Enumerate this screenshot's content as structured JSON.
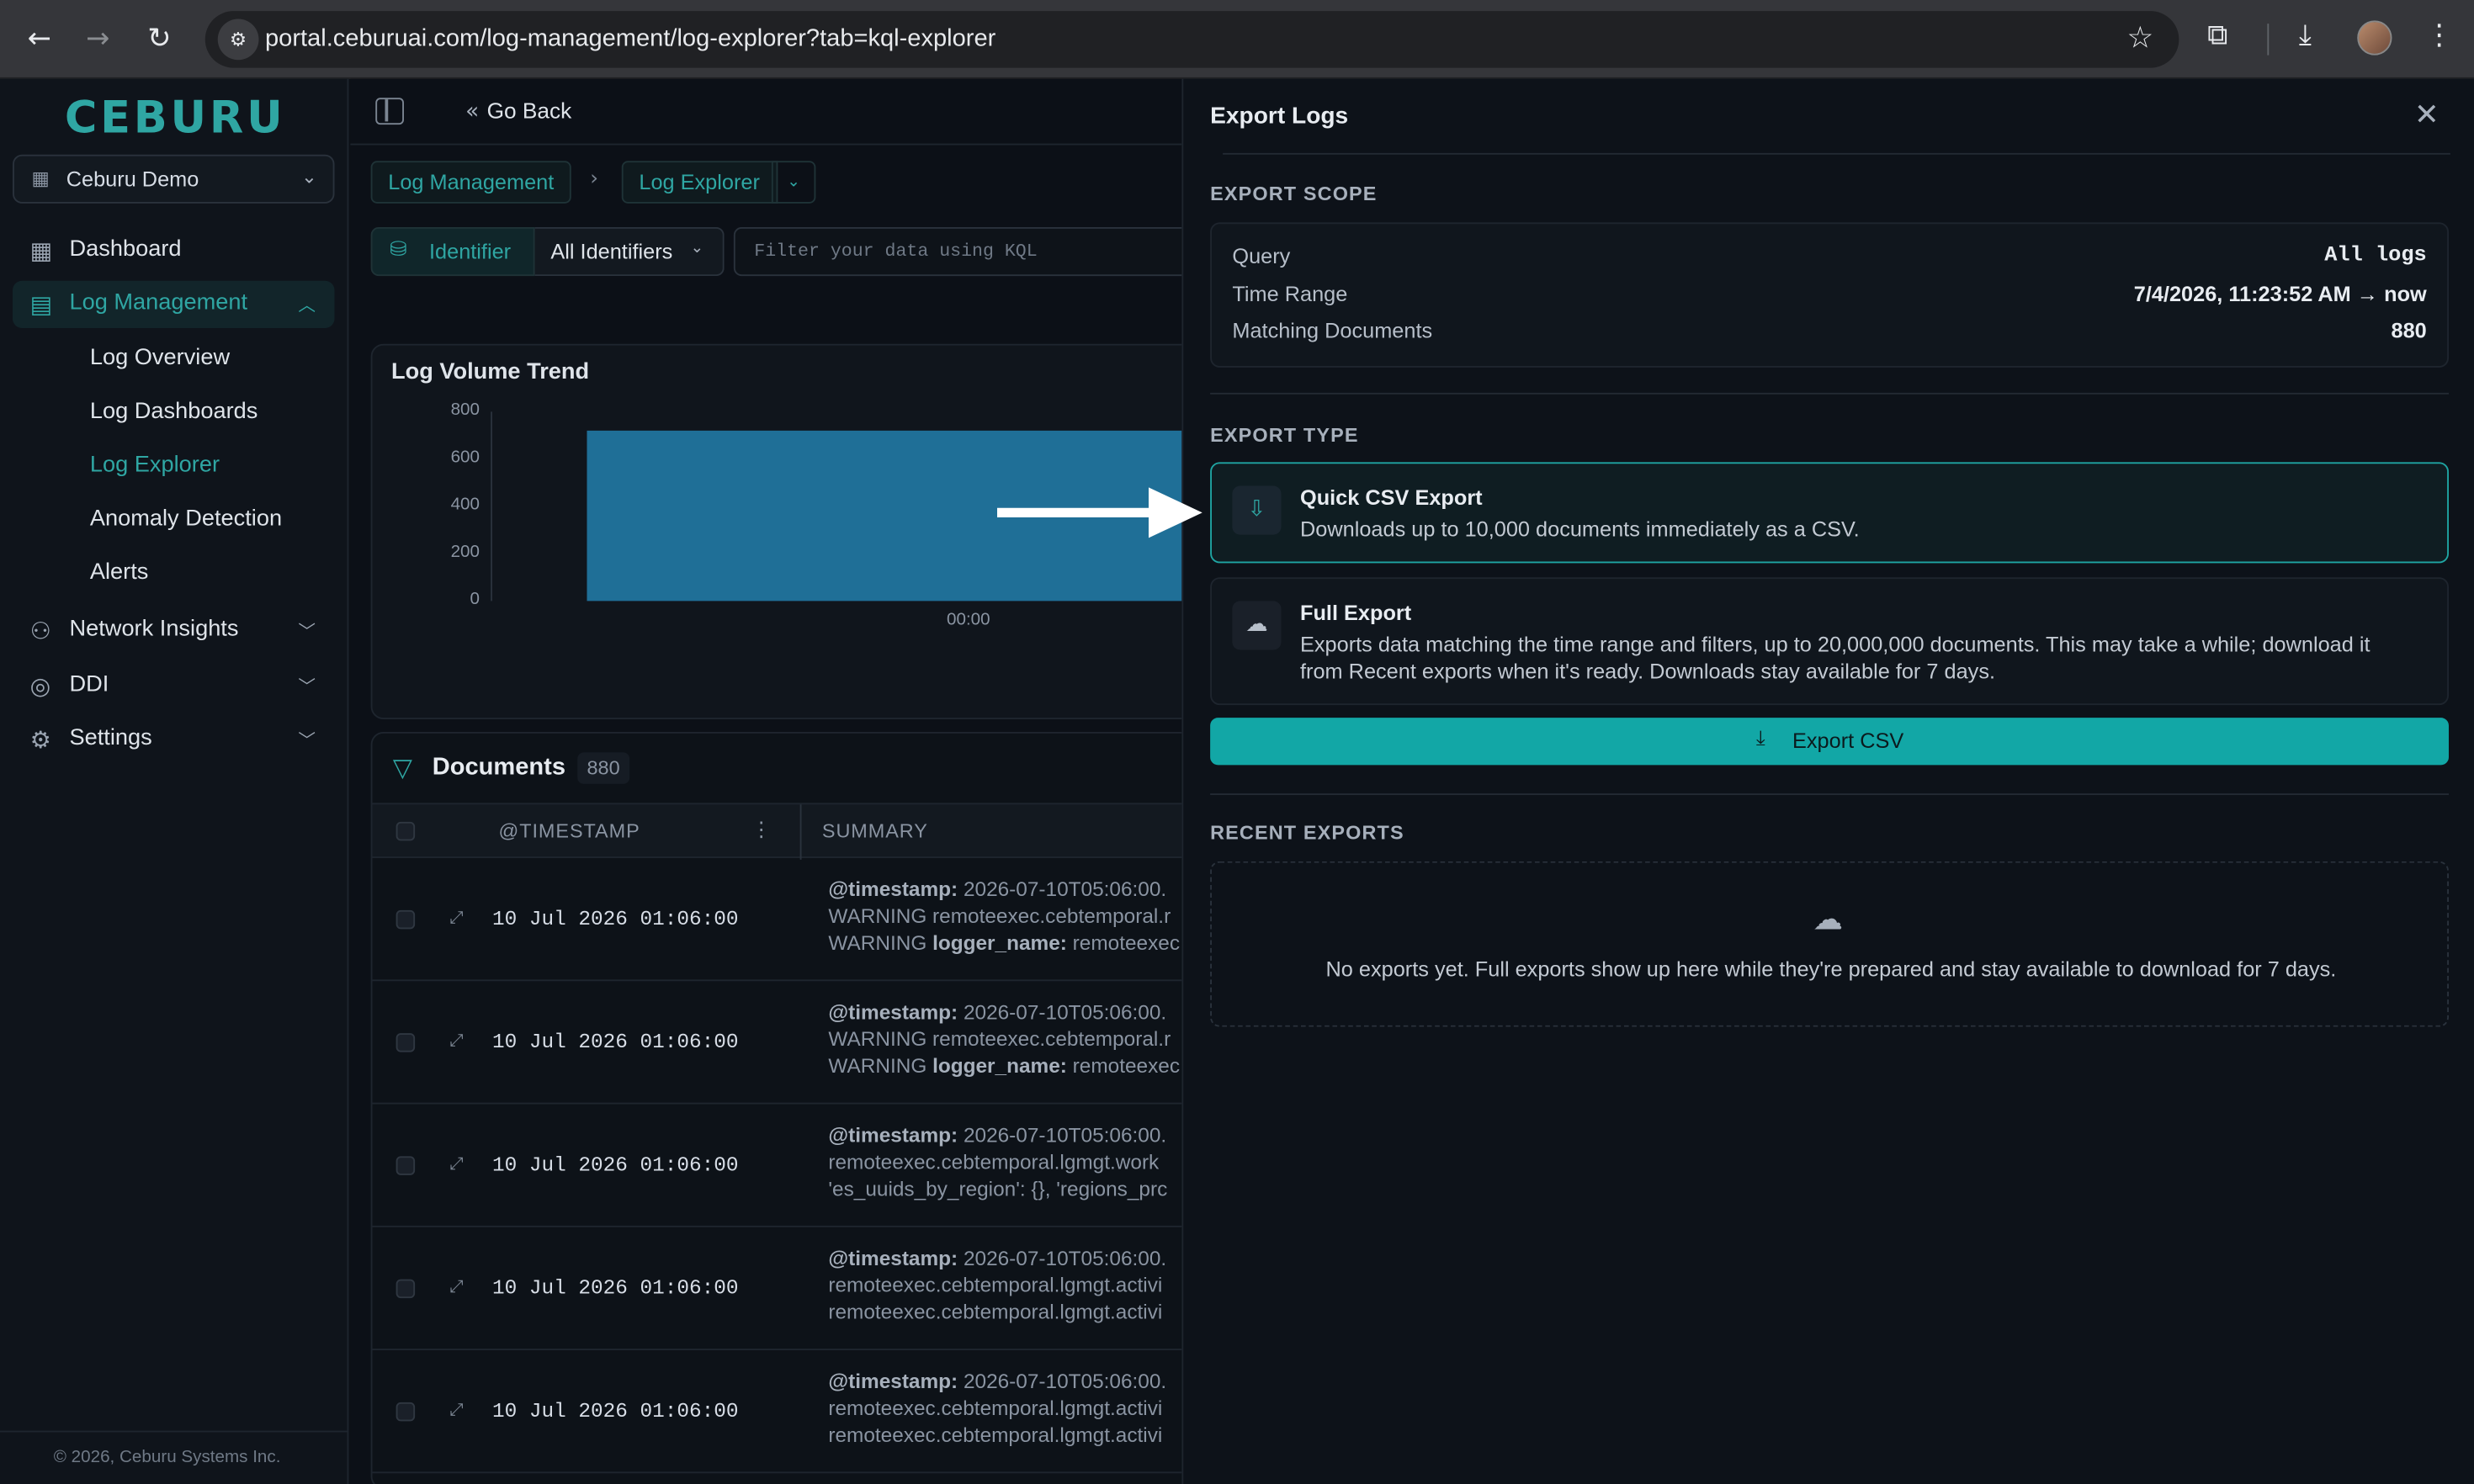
{
  "browser": {
    "url": "portal.ceburuai.com/log-management/log-explorer?tab=kql-explorer",
    "icons": [
      "back-icon",
      "forward-icon",
      "reload-icon",
      "site-info-icon",
      "bookmark-star-icon",
      "extensions-icon",
      "download-icon",
      "profile-avatar",
      "menu-icon"
    ]
  },
  "sidebar": {
    "logo": "CEBURU",
    "org": "Ceburu Demo",
    "items": [
      {
        "label": "Dashboard",
        "icon": "grid-icon"
      },
      {
        "label": "Log Management",
        "icon": "document-icon",
        "active": true
      },
      {
        "label": "Network Insights",
        "icon": "network-icon"
      },
      {
        "label": "DDI",
        "icon": "globe-icon"
      },
      {
        "label": "Settings",
        "icon": "gear-icon"
      }
    ],
    "sub_items": [
      "Log Overview",
      "Log Dashboards",
      "Log Explorer",
      "Anomaly Detection",
      "Alerts"
    ],
    "footer": "© 2026, Ceburu Systems Inc."
  },
  "main": {
    "go_back": "Go Back",
    "breadcrumb": [
      "Log Management",
      "Log Explorer"
    ],
    "identifier_label": "Identifier",
    "identifier_value": "All Identifiers",
    "kql_placeholder": "Filter your data using KQL",
    "chart_title": "Log Volume Trend",
    "documents_title": "Documents",
    "documents_count": "880",
    "columns": [
      "@TIMESTAMP",
      "SUMMARY"
    ],
    "rows": [
      {
        "ts": "10 Jul 2026 01:06:00",
        "l1k": "@timestamp:",
        "l1v": " 2026-07-10T05:06:00.",
        "l2": "WARNING remoteexec.cebtemporal.r",
        "l3k": "WARNING logger_name:",
        "l3v": " remoteexec"
      },
      {
        "ts": "10 Jul 2026 01:06:00",
        "l1k": "@timestamp:",
        "l1v": " 2026-07-10T05:06:00.",
        "l2": "WARNING remoteexec.cebtemporal.r",
        "l3k": "WARNING logger_name:",
        "l3v": " remoteexec"
      },
      {
        "ts": "10 Jul 2026 01:06:00",
        "l1k": "@timestamp:",
        "l1v": " 2026-07-10T05:06:00.",
        "l2": "remoteexec.cebtemporal.lgmgt.work",
        "l3k": "",
        "l3v": "'es_uuids_by_region': {}, 'regions_prc"
      },
      {
        "ts": "10 Jul 2026 01:06:00",
        "l1k": "@timestamp:",
        "l1v": " 2026-07-10T05:06:00.",
        "l2": "remoteexec.cebtemporal.lgmgt.activi",
        "l3k": "",
        "l3v": "remoteexec.cebtemporal.lgmgt.activi"
      },
      {
        "ts": "10 Jul 2026 01:06:00",
        "l1k": "@timestamp:",
        "l1v": " 2026-07-10T05:06:00.",
        "l2": "remoteexec.cebtemporal.lgmgt.activi",
        "l3k": "",
        "l3v": "remoteexec.cebtemporal.lgmgt.activi"
      }
    ]
  },
  "chart_data": {
    "type": "bar",
    "title": "Log Volume Trend",
    "categories": [
      "00:00"
    ],
    "values": [
      720
    ],
    "ylim": [
      0,
      800
    ],
    "yticks": [
      "800",
      "600",
      "400",
      "200",
      "0"
    ],
    "xticks": [
      "00:00"
    ],
    "colors": {
      "bar": "#1f6f97"
    }
  },
  "drawer": {
    "title": "Export Logs",
    "scope_label": "EXPORT SCOPE",
    "scope": [
      {
        "k": "Query",
        "v": "All logs"
      },
      {
        "k": "Time Range",
        "v": "7/4/2026, 11:23:52 AM → now"
      },
      {
        "k": "Matching Documents",
        "v": "880"
      }
    ],
    "type_label": "EXPORT TYPE",
    "quick": {
      "title": "Quick CSV Export",
      "desc": "Downloads up to 10,000 documents immediately as a CSV."
    },
    "full": {
      "title": "Full Export",
      "desc": "Exports data matching the time range and filters, up to 20,000,000 documents. This may take a while; download it from Recent exports when it's ready. Downloads stay available for 7 days."
    },
    "export_button": "Export CSV",
    "recent_label": "RECENT EXPORTS",
    "empty_text": "No exports yet. Full exports show up here while they're prepared and stay available to download for 7 days."
  },
  "colors": {
    "accent": "#2fa6a3",
    "button": "#12a7a6",
    "background": "#0c1017"
  }
}
